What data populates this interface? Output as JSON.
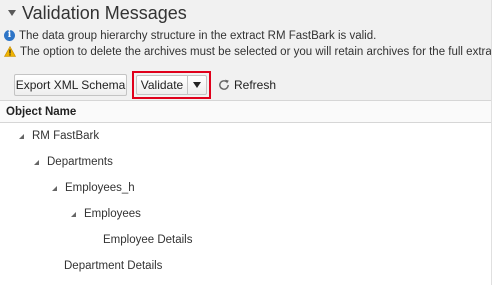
{
  "section": {
    "title": "Validation Messages"
  },
  "messages": [
    {
      "type": "info",
      "icon": "info-icon",
      "text": "The data group hierarchy structure in the extract RM FastBark is valid."
    },
    {
      "type": "warning",
      "icon": "warning-icon",
      "text": "The option to delete the archives must be selected or you will retain archives for the full extracts"
    }
  ],
  "toolbar": {
    "export_label": "Export XML Schema",
    "validate_label": "Validate",
    "refresh_label": "Refresh"
  },
  "table": {
    "column_header": "Object Name"
  },
  "tree": [
    {
      "label": "RM FastBark",
      "level": 0,
      "expanded": true
    },
    {
      "label": "Departments",
      "level": 1,
      "expanded": true
    },
    {
      "label": "Employees_h",
      "level": 2,
      "expanded": true
    },
    {
      "label": "Employees",
      "level": 3,
      "expanded": true
    },
    {
      "label": "Employee Details",
      "level": 4,
      "expanded": false
    },
    {
      "label": "Department Details",
      "level": 1,
      "expanded": false
    }
  ],
  "colors": {
    "highlight_border": "#e0001b",
    "info_icon": "#2e75c7",
    "warning_icon": "#f0b400"
  }
}
